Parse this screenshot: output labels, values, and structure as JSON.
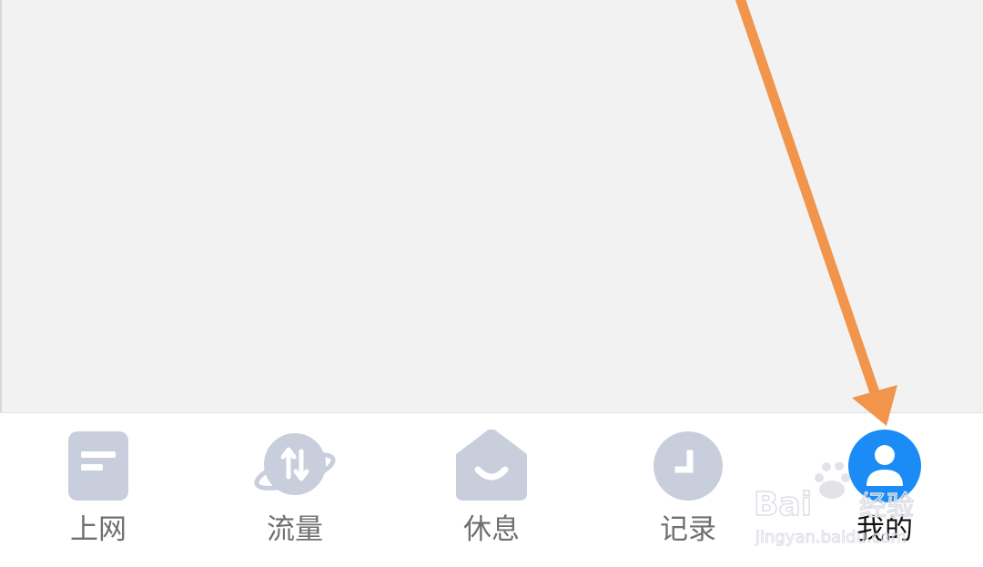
{
  "colors": {
    "content_background": "#f3f2f2",
    "tab_bar_background": "#ffffff",
    "inactive_icon": "#c9cedd",
    "active_icon": "#1b8cf5",
    "inactive_label": "#6f6f6f",
    "active_label": "#111111",
    "annotation_arrow": "#f0954b"
  },
  "tab_bar": {
    "active_tab": "我的",
    "tabs": [
      {
        "label": "上网",
        "icon": "document-icon"
      },
      {
        "label": "流量",
        "icon": "planet-transfer-icon"
      },
      {
        "label": "休息",
        "icon": "smile-house-icon"
      },
      {
        "label": "记录",
        "icon": "clock-icon"
      },
      {
        "label": "我的",
        "icon": "user-profile-icon"
      }
    ]
  },
  "watermark": {
    "brand": "Baidu 经验",
    "url": "jingyan.baidu.com"
  }
}
